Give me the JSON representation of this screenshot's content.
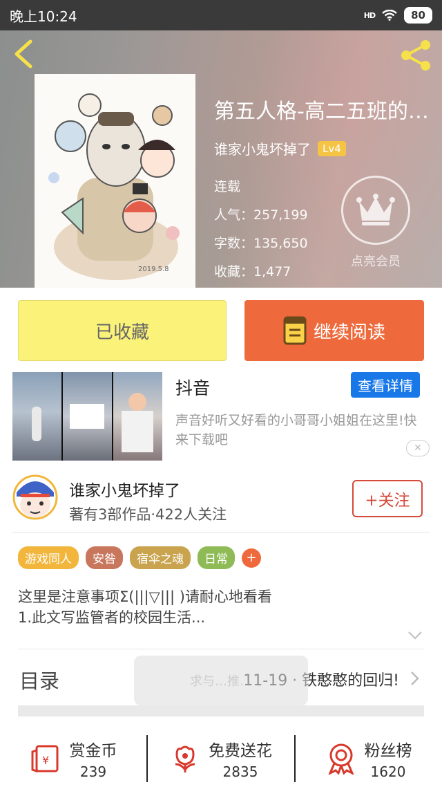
{
  "status_bar": {
    "time": "晚上10:24",
    "signal": "HD",
    "battery": "80"
  },
  "book": {
    "title": "第五人格-高二五班的日常",
    "author": "谁家小鬼坏掉了",
    "level": "Lv4",
    "status": "连载",
    "popularity": "人气：257,199",
    "word_count": "字数：135,650",
    "favorites": "收藏：1,477"
  },
  "vip": {
    "label": "点亮会员"
  },
  "actions": {
    "collected_label": "已收藏",
    "continue_label": "继续阅读"
  },
  "ad": {
    "title": "抖音",
    "detail_label": "查看详情",
    "description": "声音好听又好看的小哥哥小姐姐在这里!快来下载吧",
    "close_label": "✕"
  },
  "author_card": {
    "name": "谁家小鬼坏掉了",
    "stats": "著有3部作品·422人关注",
    "follow_label": "+关注"
  },
  "tags": [
    {
      "label": "游戏同人",
      "color": "#f2b63c"
    },
    {
      "label": "安咎",
      "color": "#c8765c"
    },
    {
      "label": "宿伞之魂",
      "color": "#c9a34e"
    },
    {
      "label": "日常",
      "color": "#8fbb57"
    }
  ],
  "tag_add": "+",
  "description": {
    "line1": "这里是注意事项Σ(|||▽||| )请耐心地看看",
    "line2": "1.此文写监管者的校园生活..."
  },
  "toc": {
    "label": "目录",
    "latest": "11-19 · 铁憨憨的回归!"
  },
  "toast": "求与…推…",
  "bottom": [
    {
      "label": "赏金币",
      "value": "239"
    },
    {
      "label": "免费送花",
      "value": "2835"
    },
    {
      "label": "粉丝榜",
      "value": "1620"
    }
  ],
  "colors": {
    "accent": "#ee6a3c",
    "collected": "#fbf27a",
    "follow": "#d54a3a",
    "ad_button": "#1878e8",
    "badge": "#f6c444"
  }
}
